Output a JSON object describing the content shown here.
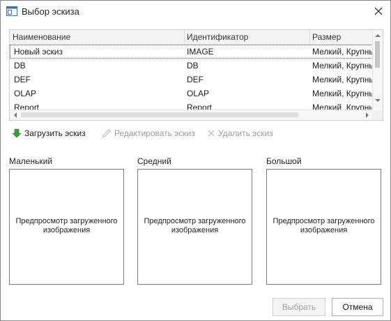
{
  "window": {
    "title": "Выбор эскиза"
  },
  "grid": {
    "columns": [
      "Наименование",
      "Идентификатор",
      "Размер"
    ],
    "rows": [
      {
        "name": "Новый эскиз",
        "id": "IMAGE",
        "size": "Мелкий, Крупны"
      },
      {
        "name": "DB",
        "id": "DB",
        "size": "Мелкий, Крупны"
      },
      {
        "name": "DEF",
        "id": "DEF",
        "size": "Мелкий, Крупны"
      },
      {
        "name": "OLAP",
        "id": "OLAP",
        "size": "Мелкий, Крупны"
      },
      {
        "name": "Report",
        "id": "Report",
        "size": "Мелкий, Крупны"
      }
    ]
  },
  "toolbar": {
    "upload_label": "Загрузить эскиз",
    "edit_label": "Редактировать эскиз",
    "delete_label": "Удалить эскиз"
  },
  "previews": [
    {
      "label": "Маленький",
      "placeholder_line1": "Предпросмотр загруженного",
      "placeholder_line2": "изображения"
    },
    {
      "label": "Средний",
      "placeholder_line1": "Предпросмотр загруженного",
      "placeholder_line2": "изображения"
    },
    {
      "label": "Большой",
      "placeholder_line1": "Предпросмотр загруженного",
      "placeholder_line2": "изображения"
    }
  ],
  "buttons": {
    "select_label": "Выбрать",
    "cancel_label": "Отмена"
  },
  "colors": {
    "upload_arrow": "#3f9a3a",
    "disabled_text": "#9a9a9a",
    "border": "#7a7a7a"
  },
  "icons": [
    "window-icon",
    "close-icon",
    "upload-arrow-icon",
    "edit-pencil-icon",
    "delete-x-icon",
    "scroll-up-icon",
    "scroll-down-icon",
    "scroll-left-icon",
    "scroll-right-icon"
  ]
}
